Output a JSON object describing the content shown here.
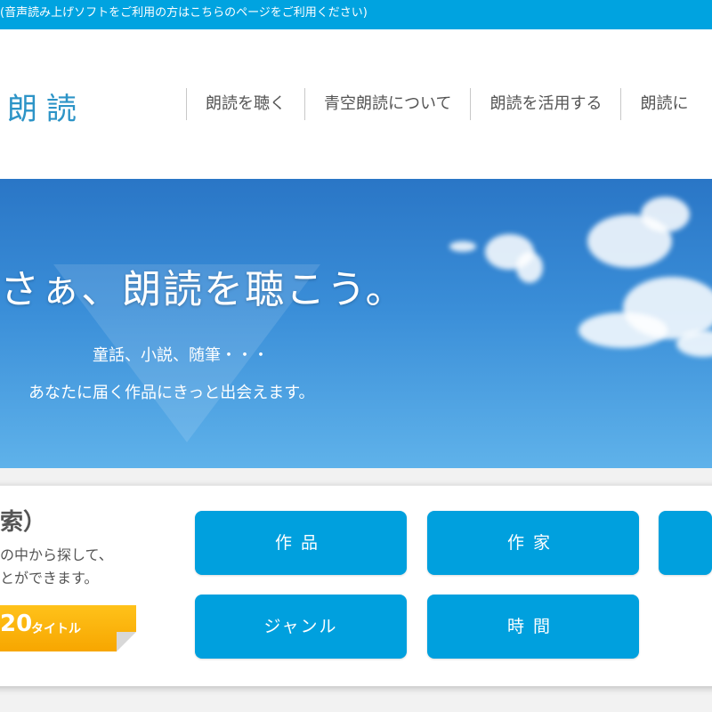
{
  "notice": {
    "text": "(音声読み上げソフトをご利用の方はこちらのページをご利用ください)"
  },
  "header": {
    "logo": "朗読",
    "nav": [
      {
        "label": "朗読を聴く"
      },
      {
        "label": "青空朗読について"
      },
      {
        "label": "朗読を活用する"
      },
      {
        "label": "朗読に"
      }
    ]
  },
  "hero": {
    "title": "さぁ、朗読を聴こう。",
    "subtitle_line1": "童話、小説、随筆・・・",
    "subtitle_line2": "あなたに届く作品にきっと出会えます。"
  },
  "search": {
    "title": "索）",
    "description_line1": "の中から探して、",
    "description_line2": "とができます。",
    "count_number": "20",
    "count_unit": "タイトル",
    "categories": [
      {
        "label": "作品"
      },
      {
        "label": "作家"
      },
      {
        "label": "ジャンル"
      },
      {
        "label": "時間"
      }
    ]
  },
  "colors": {
    "brand_blue": "#00a3e0",
    "button_blue": "#00a0de",
    "badge_orange": "#f7a600"
  }
}
